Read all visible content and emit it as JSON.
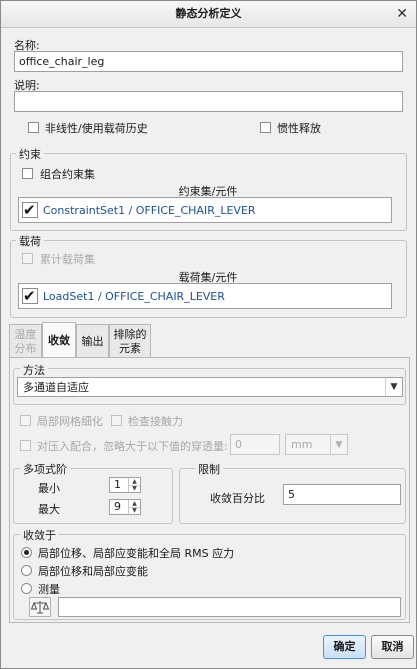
{
  "window": {
    "title": "静态分析定义",
    "close_glyph": "✕"
  },
  "name_field": {
    "label": "名称:",
    "value": "office_chair_leg"
  },
  "description_field": {
    "label": "说明:",
    "value": ""
  },
  "options": {
    "nonlinear_label": "非线性/使用载荷历史",
    "inertia_relief_label": "惯性释放"
  },
  "constraints": {
    "title": "约束",
    "combine_label": "组合约束集",
    "column_header": "约束集/元件",
    "items": [
      {
        "text": "ConstraintSet1 / OFFICE_CHAIR_LEVER",
        "checked": true
      }
    ]
  },
  "loads": {
    "title": "载荷",
    "cumulative_label": "累计载荷集",
    "column_header": "载荷集/元件",
    "items": [
      {
        "text": "LoadSet1 / OFFICE_CHAIR_LEVER",
        "checked": true
      }
    ]
  },
  "tabs": [
    {
      "line1": "温度",
      "line2": "分布",
      "state": "disabled"
    },
    {
      "line1": "收敛",
      "line2": "",
      "state": "active"
    },
    {
      "line1": "输出",
      "line2": "",
      "state": "normal"
    },
    {
      "line1": "排除的",
      "line2": "元素",
      "state": "normal"
    }
  ],
  "method": {
    "title": "方法",
    "selected": "多通道自适应"
  },
  "mesh_options": {
    "local_refine_label": "局部网格细化",
    "check_contact_label": "检查接触力",
    "press_fit_label": "对压入配合，忽略大于以下值的穿透量:",
    "press_fit_value": "0",
    "press_fit_unit": "mm"
  },
  "polynomial_order": {
    "title": "多项式阶",
    "min_label": "最小",
    "min_value": "1",
    "max_label": "最大",
    "max_value": "9"
  },
  "limits": {
    "title": "限制",
    "convergence_label": "收敛百分比",
    "convergence_value": "5"
  },
  "converge_on": {
    "title": "收敛于",
    "options": [
      {
        "label": "局部位移、局部应变能和全局 RMS 应力",
        "selected": true
      },
      {
        "label": "局部位移和局部应变能",
        "selected": false
      },
      {
        "label": "测量",
        "selected": false
      }
    ],
    "measure_value": ""
  },
  "buttons": {
    "ok": "确定",
    "cancel": "取消"
  },
  "icons": {
    "close": "close-icon",
    "measure": "measure-scale-icon",
    "spin_up": "▲",
    "spin_down": "▼",
    "dropdown": "▼",
    "check": "✔"
  }
}
